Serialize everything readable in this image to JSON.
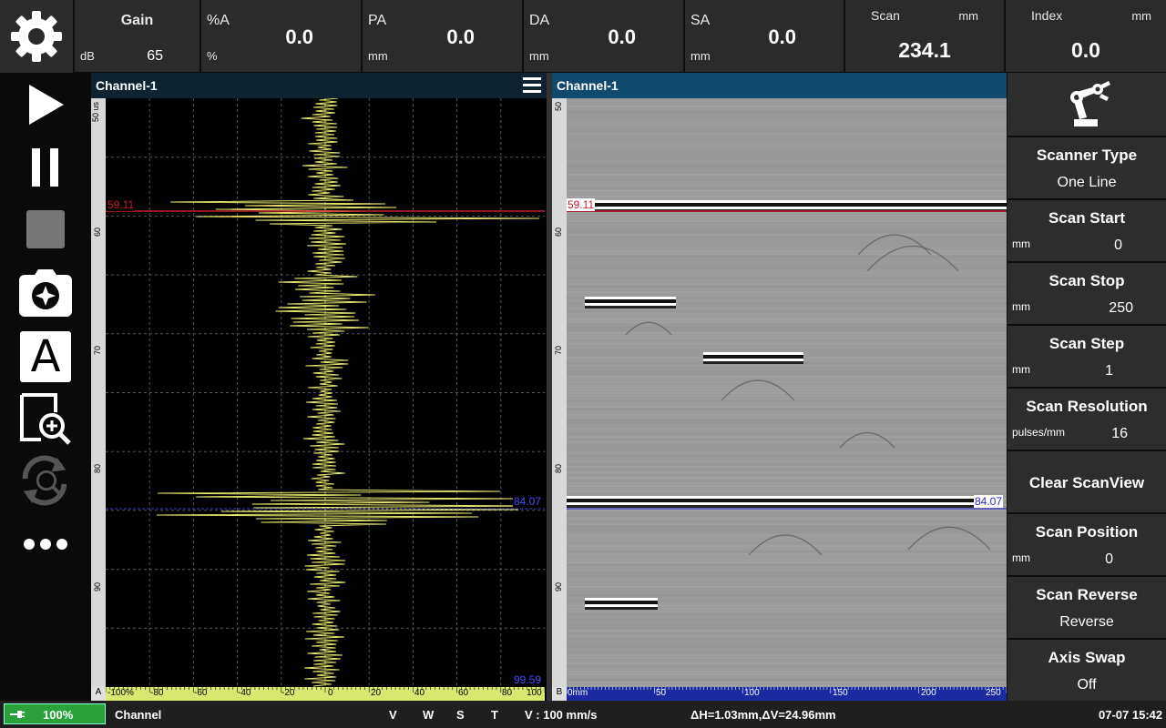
{
  "topbar": {
    "gain": {
      "label": "Gain",
      "unit": "dB",
      "value": "65"
    },
    "readouts": [
      {
        "label": "%A",
        "unit": "%",
        "value": "0.0"
      },
      {
        "label": "PA",
        "unit": "mm",
        "value": "0.0"
      },
      {
        "label": "DA",
        "unit": "mm",
        "value": "0.0"
      },
      {
        "label": "SA",
        "unit": "mm",
        "value": "0.0"
      }
    ],
    "scan": {
      "label": "Scan",
      "unit": "mm",
      "value": "234.1"
    },
    "index": {
      "label": "Index",
      "unit": "mm",
      "value": "0.0"
    }
  },
  "ascan": {
    "title": "Channel-1",
    "gate_top": "59.11",
    "gate_bottom": "84.07",
    "bottom_value": "99.59",
    "corner": "A",
    "xticks": [
      "-100%",
      "-80",
      "-60",
      "-40",
      "-20",
      "0",
      "20",
      "40",
      "60",
      "80",
      "100"
    ],
    "yticks": [
      "50 us",
      "60",
      "70",
      "80",
      "90"
    ]
  },
  "bscan": {
    "title": "Channel-1",
    "gate_top": "59.11",
    "gate_bottom": "84.07",
    "corner": "B",
    "xticks": [
      "0mm",
      "50",
      "100",
      "150",
      "200",
      "250"
    ],
    "yticks": [
      "50",
      "60",
      "70",
      "80",
      "90"
    ]
  },
  "menu": {
    "scanner_type": {
      "title": "Scanner Type",
      "value": "One Line"
    },
    "scan_start": {
      "title": "Scan Start",
      "unit": "mm",
      "value": "0"
    },
    "scan_stop": {
      "title": "Scan Stop",
      "unit": "mm",
      "value": "250"
    },
    "scan_step": {
      "title": "Scan Step",
      "unit": "mm",
      "value": "1"
    },
    "scan_resolution": {
      "title": "Scan Resolution",
      "unit": "pulses/mm",
      "value": "16"
    },
    "clear_scanview": {
      "title": "Clear ScanView"
    },
    "scan_position": {
      "title": "Scan Position",
      "unit": "mm",
      "value": "0"
    },
    "scan_reverse": {
      "title": "Scan Reverse",
      "value": "Reverse"
    },
    "axis_swap": {
      "title": "Axis Swap",
      "value": "Off"
    }
  },
  "status": {
    "battery": "100%",
    "channel": "Channel",
    "v": "V",
    "w": "W",
    "s": "S",
    "t": "T",
    "velocity": "V : 100 mm/s",
    "delta": "ΔH=1.03mm,ΔV=24.96mm",
    "datetime": "07-07 15:42"
  },
  "colors": {
    "ascan_trace": "#e8e870",
    "gate_red": "#c0202a",
    "gate_blue": "#3a3ad0",
    "title_bar": "#0f2a3a",
    "battery_green": "#2aa13a",
    "hscale_yellow": "#d8e870",
    "hscale_blue": "#1a2aa0"
  }
}
